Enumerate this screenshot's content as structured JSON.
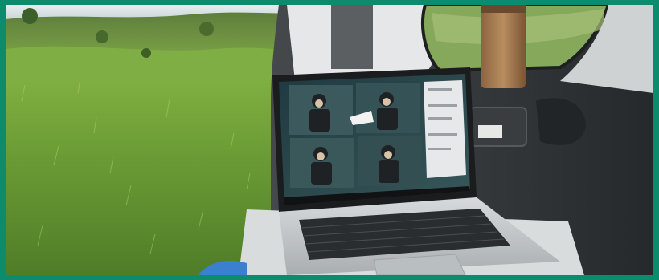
{
  "image": {
    "description_label": "laptop-in-car-trunk-photo",
    "colors": {
      "frame": "#0d8b6d",
      "sky": "#cfd9df",
      "grass_light": "#8dbb45",
      "grass_dark": "#3e6b25",
      "car_interior": "#2f3336",
      "laptop_body": "#c9cdd0",
      "screen_bg": "#2b4a4f",
      "tumbler": "#a57c52"
    }
  }
}
